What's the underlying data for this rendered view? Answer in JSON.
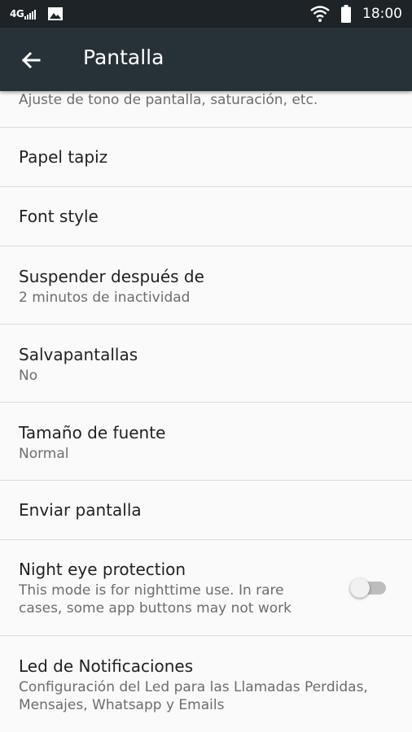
{
  "status_bar": {
    "network": "4G",
    "time": "18:00"
  },
  "app_bar": {
    "title": "Pantalla"
  },
  "settings": [
    {
      "summary": "Ajuste de tono de pantalla, saturación, etc."
    },
    {
      "title": "Papel tapiz"
    },
    {
      "title": "Font style"
    },
    {
      "title": "Suspender después de",
      "summary": "2 minutos de inactividad"
    },
    {
      "title": "Salvapantallas",
      "summary": "No"
    },
    {
      "title": "Tamaño de fuente",
      "summary": "Normal"
    },
    {
      "title": "Enviar pantalla"
    },
    {
      "title": "Night eye protection",
      "summary_lines": [
        "This mode is for nighttime use. In rare",
        "cases, some app buttons may not work"
      ],
      "toggle_on": false
    },
    {
      "title": "Led de Notificaciones",
      "summary_lines": [
        "Configuración del Led para las Llamadas Perdidas,",
        "Mensajes, Whatsapp y Emails"
      ]
    }
  ],
  "colors": {
    "status_bar": "#1d2326",
    "app_bar": "#263238",
    "background": "#fafafa",
    "divider": "#dcdcdc"
  }
}
